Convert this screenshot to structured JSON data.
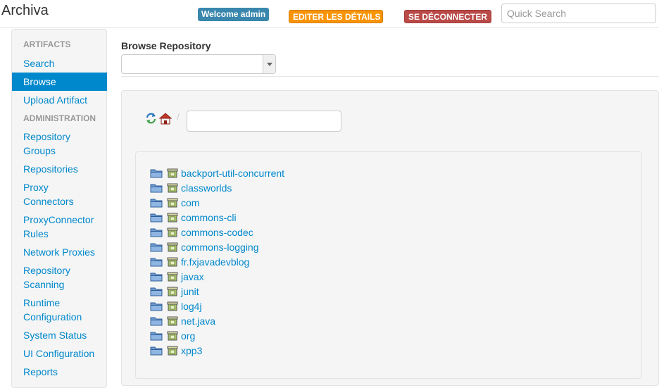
{
  "app": {
    "brand": "Archiva"
  },
  "header": {
    "welcome": "Welcome admin",
    "edit_details": "EDITER LES DÉTAILS",
    "logout": "SE DÉCONNECTER",
    "search_placeholder": "Quick Search"
  },
  "sidebar": {
    "artifacts_header": "ARTIFACTS",
    "search": "Search",
    "browse": "Browse",
    "upload": "Upload Artifact",
    "admin_header": "ADMINISTRATION",
    "repo_groups_1": "Repository",
    "repo_groups_2": "Groups",
    "repositories": "Repositories",
    "proxy_1": "Proxy",
    "proxy_2": "Connectors",
    "pc_rules_1": "ProxyConnector",
    "pc_rules_2": "Rules",
    "network_proxies": "Network Proxies",
    "scanning_1": "Repository",
    "scanning_2": "Scanning",
    "runtime_1": "Runtime",
    "runtime_2": "Configuration",
    "system_status": "System Status",
    "ui_config": "UI Configuration",
    "reports": "Reports"
  },
  "main": {
    "title": "Browse Repository",
    "breadcrumb_separator": "/",
    "tree": [
      "backport-util-concurrent",
      "classworlds",
      "com",
      "commons-cli",
      "commons-codec",
      "commons-logging",
      "fr.fxjavadevblog",
      "javax",
      "junit",
      "log4j",
      "net.java",
      "org",
      "xpp3"
    ]
  },
  "colors": {
    "link": "#0088cc",
    "active": "#0088cc",
    "warning": "#f89406",
    "danger": "#b94a48",
    "info": "#3a87ad"
  }
}
